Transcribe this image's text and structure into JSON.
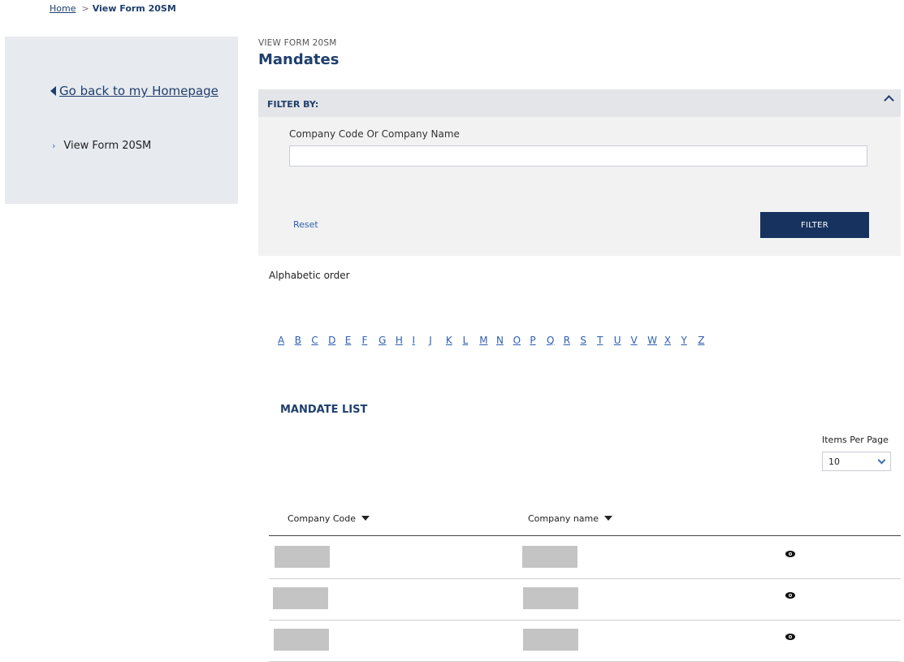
{
  "breadcrumb": {
    "home": "Home",
    "separator": ">",
    "current": "View Form 20SM"
  },
  "sidebar": {
    "back_link": "Go back to my Homepage",
    "items": [
      {
        "label": "View Form 20SM"
      }
    ]
  },
  "header": {
    "kicker": "VIEW FORM 20SM",
    "title": "Mandates"
  },
  "filter": {
    "heading": "FILTER BY:",
    "field_label": "Company Code Or Company Name",
    "field_value": "",
    "reset_label": "Reset",
    "filter_button": "FILTER"
  },
  "alphabet": {
    "label": "Alphabetic order",
    "letters": [
      "A",
      "B",
      "C",
      "D",
      "E",
      "F",
      "G",
      "H",
      "I",
      "J",
      "K",
      "L",
      "M",
      "N",
      "O",
      "P",
      "Q",
      "R",
      "S",
      "T",
      "U",
      "V",
      "W",
      "X",
      "Y",
      "Z"
    ]
  },
  "list": {
    "title": "MANDATE LIST",
    "items_per_page_label": "Items Per Page",
    "items_per_page_value": "10",
    "columns": {
      "code": "Company Code",
      "name": "Company name"
    },
    "rows": [
      {
        "code": "",
        "name": "",
        "view_icon": "eye-icon"
      },
      {
        "code": "",
        "name": "",
        "view_icon": "eye-icon"
      },
      {
        "code": "",
        "name": "",
        "view_icon": "eye-icon"
      }
    ]
  },
  "colors": {
    "navy": "#1f3f6d",
    "button": "#17325f",
    "link": "#2d5fb0",
    "panel": "#e7eaef"
  }
}
